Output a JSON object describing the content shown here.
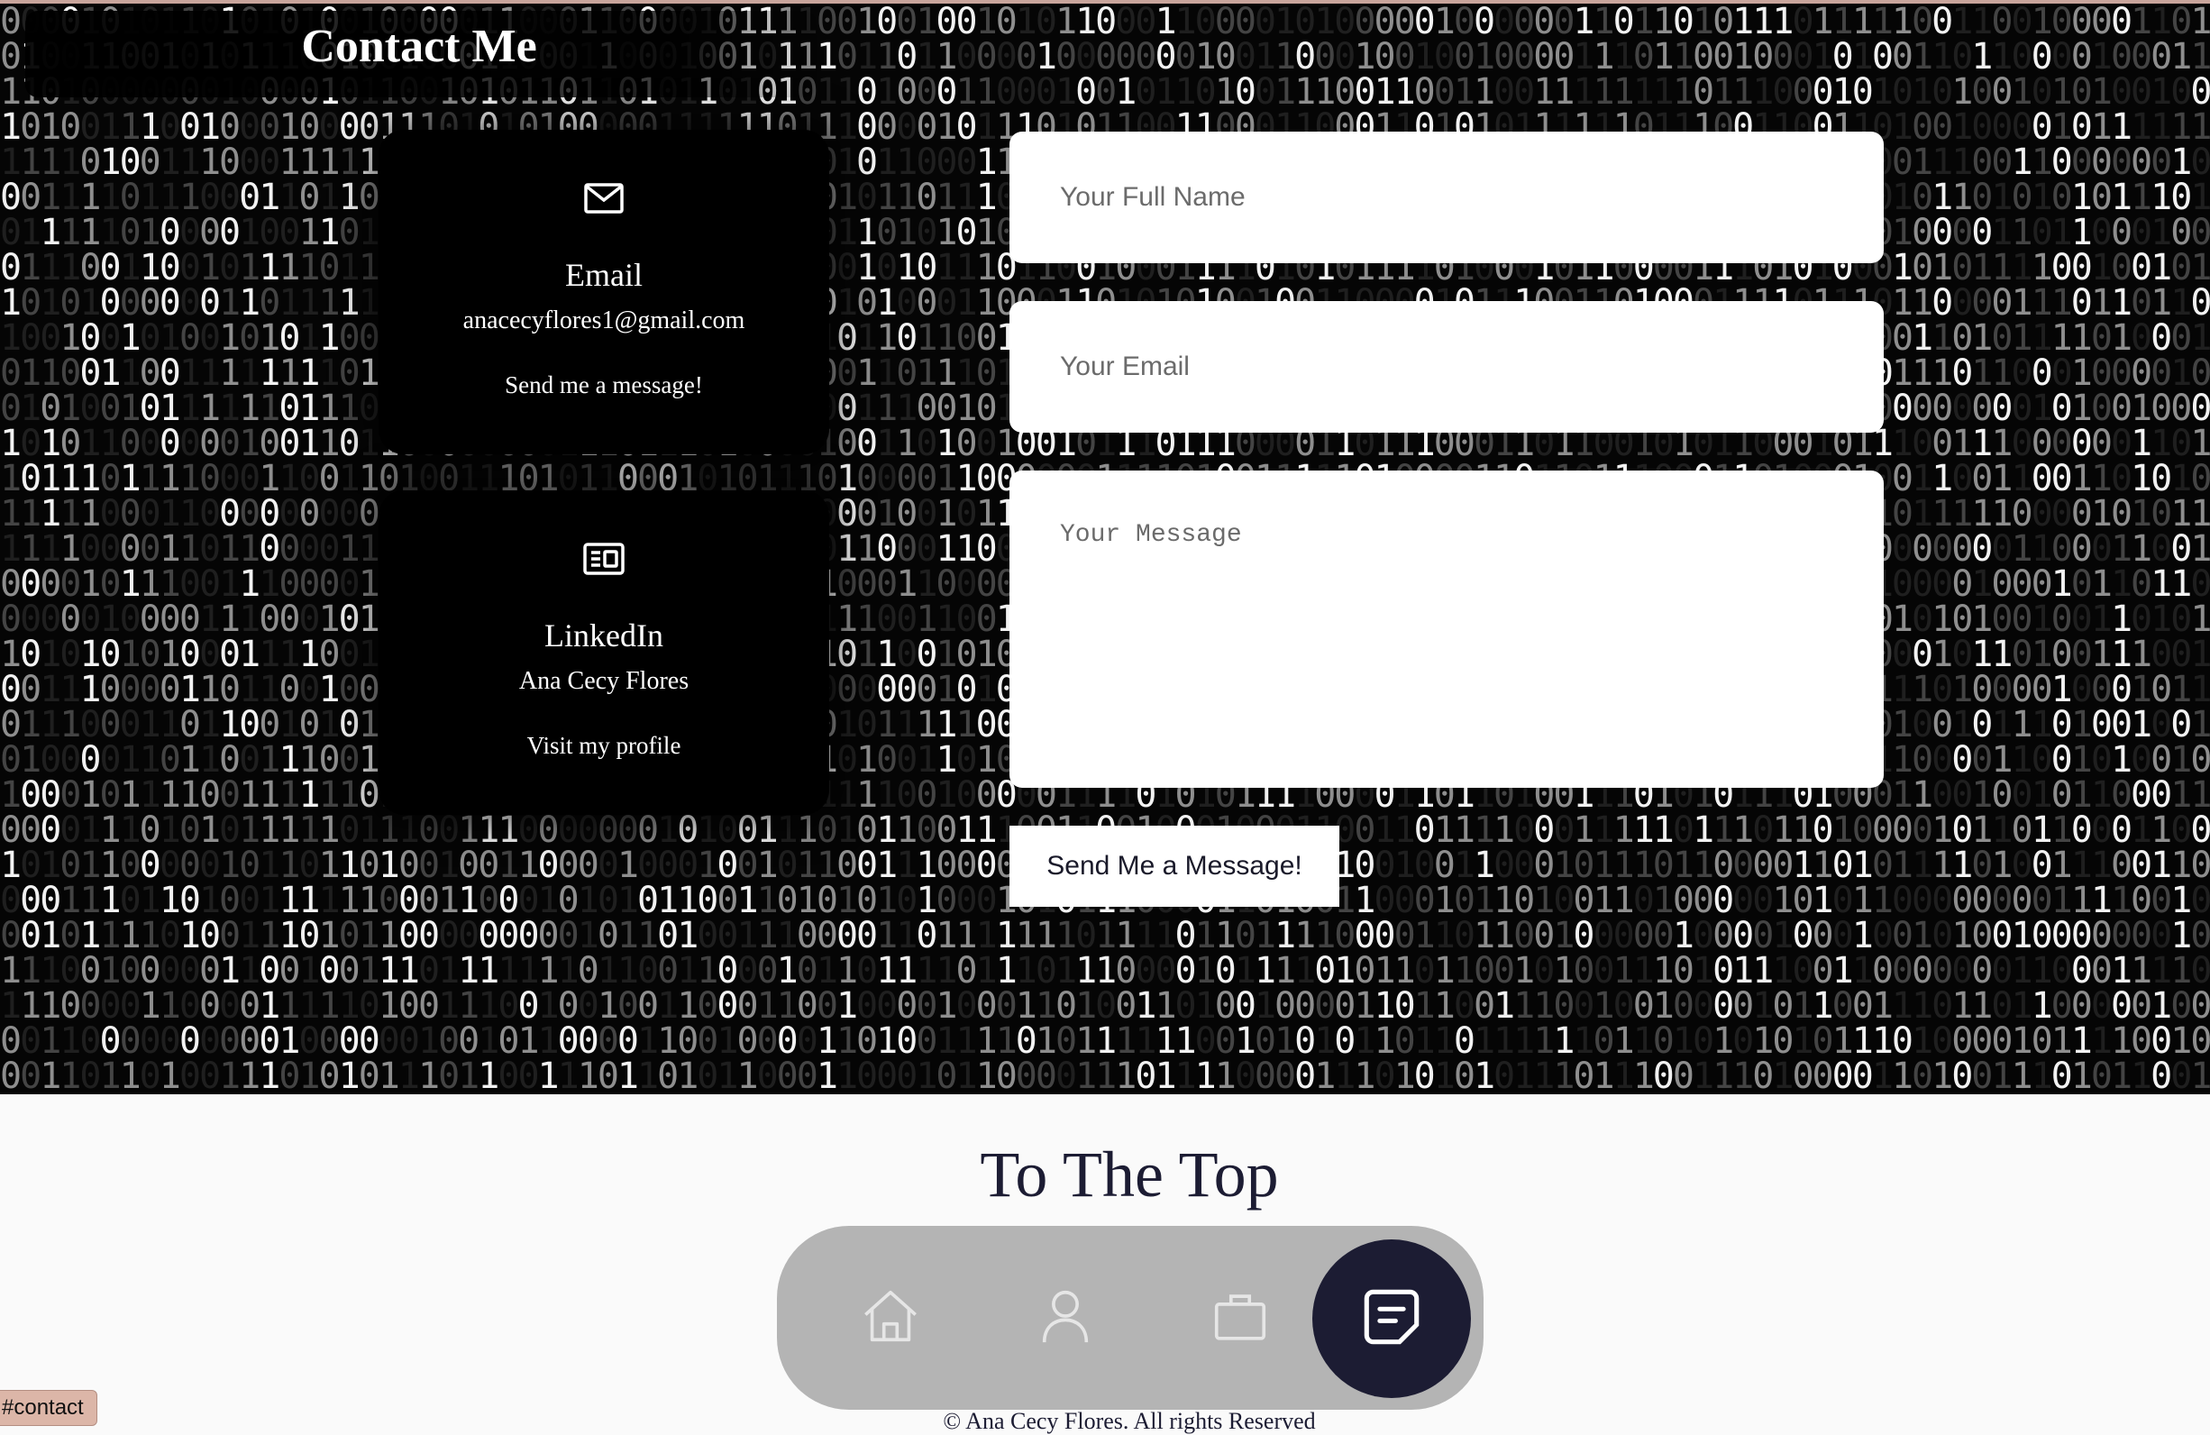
{
  "contact": {
    "title": "Contact Me"
  },
  "cards": {
    "email": {
      "icon": "envelope-icon",
      "title": "Email",
      "detail": "anacecyflores1@gmail.com",
      "link": "Send me a message!"
    },
    "linkedin": {
      "icon": "linkedin-newspaper-icon",
      "title": "LinkedIn",
      "detail": "Ana Cecy Flores",
      "link": "Visit my profile"
    }
  },
  "form": {
    "name_placeholder": "Your Full Name",
    "email_placeholder": "Your Email",
    "message_placeholder": "Your Message",
    "submit_label": "Send Me a Message!"
  },
  "footer": {
    "to_top": "To The Top",
    "copyright": "© Ana Cecy Flores. All rights Reserved"
  },
  "nav": {
    "items": [
      {
        "icon": "home-icon",
        "active": false
      },
      {
        "icon": "user-icon",
        "active": false
      },
      {
        "icon": "briefcase-icon",
        "active": false
      },
      {
        "icon": "message-icon",
        "active": true
      }
    ]
  },
  "status_bar": {
    "url": "#contact"
  },
  "colors": {
    "background_dark": "#050505",
    "nav_active": "#1c1c33",
    "nav_bar": "#b4b4b4",
    "status_bar": "#dcb6a8"
  }
}
